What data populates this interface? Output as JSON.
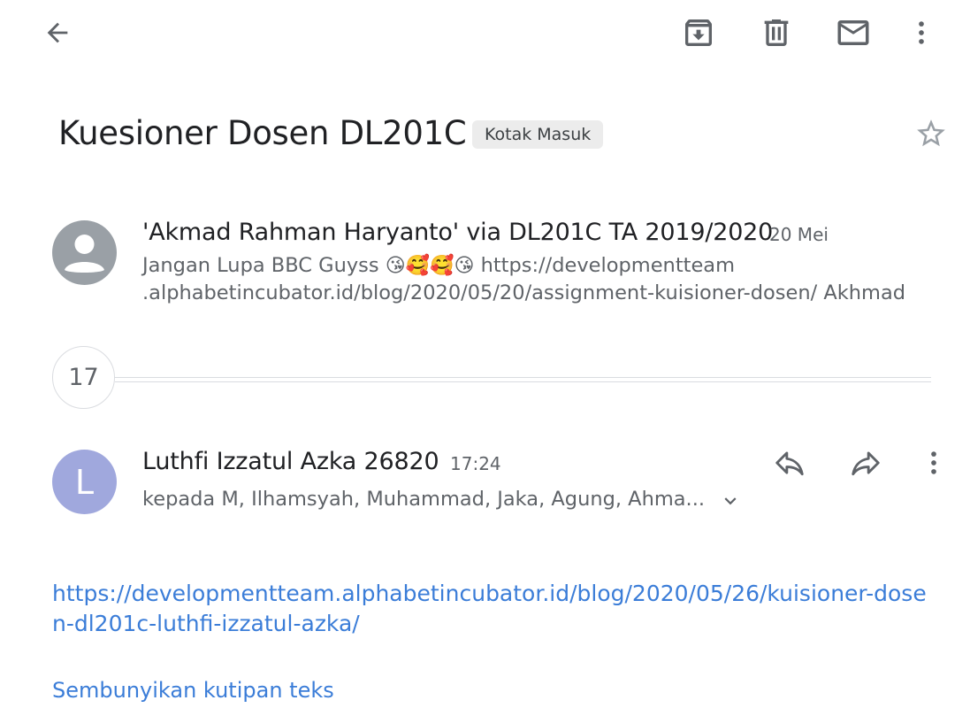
{
  "toolbar": {
    "back_icon": "arrow-back-icon",
    "archive_icon": "archive-icon",
    "delete_icon": "trash-icon",
    "mark_unread_icon": "mail-icon",
    "more_icon": "more-vert-icon"
  },
  "thread": {
    "subject": "Kuesioner Dosen DL201C",
    "label": "Kotak Masuk",
    "star_icon": "star-outline-icon"
  },
  "collapsed_message": {
    "sender": "'Akmad Rahman Haryanto' via DL201C TA 2019/2020",
    "date": "20 Mei",
    "snippet_text": "Jangan Lupa BBC Guyss",
    "snippet_emoji": "😘🥰🥰😘",
    "snippet_link_line1": "https://developmentteam",
    "snippet_link_line2": ".alphabetincubator.id/blog/2020/05/20/assignment-kuisioner-dosen/ Akhmad",
    "avatar_icon": "person-avatar-icon"
  },
  "hidden_count": "17",
  "message": {
    "avatar_letter": "L",
    "sender": "Luthfi Izzatul Azka 26820",
    "time": "17:24",
    "recipients": "kepada M, Ilhamsyah, Muhammad, Jaka, Agung, Ahma...",
    "reply_icon": "reply-icon",
    "forward_icon": "forward-icon",
    "more_icon": "more-vert-icon",
    "expand_icon": "chevron-down-icon"
  },
  "body": {
    "link": "https://developmentteam.alphabetincubator.id/blog/2020/05/26/kuisioner-dosen-dl201c-luthfi-izzatul-azka/",
    "hide_quoted_text": "Sembunyikan kutipan teks"
  },
  "colors": {
    "link": "#3b7dd8",
    "avatar_L": "#a0a8dd",
    "avatar_gray": "#9aa0a6",
    "chip_bg": "#ececec"
  }
}
